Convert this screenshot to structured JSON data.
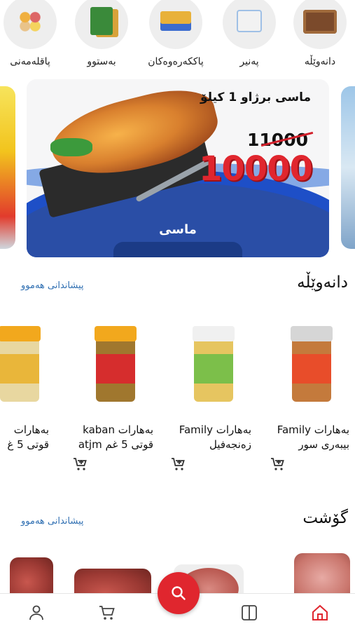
{
  "categories": [
    {
      "label": "پاقلەمەنی",
      "icon": "legumes-icon"
    },
    {
      "label": "بەستوو",
      "icon": "frozen-food-icon"
    },
    {
      "label": "پاککەرەوەکان",
      "icon": "cleaning-products-icon"
    },
    {
      "label": "پەنیر",
      "icon": "cheese-icon"
    },
    {
      "label": "دانەوێڵە",
      "icon": "grains-icon"
    }
  ],
  "banner": {
    "title": "ماسی برژاو 1 کیلۆ",
    "old_price": "11000",
    "new_price": "10000",
    "caption": "ماسی"
  },
  "sections": [
    {
      "title": "دانەوێڵە",
      "see_all": "پیشاندانی هەموو"
    },
    {
      "title": "گۆشت",
      "see_all": "پیشاندانی هەموو"
    }
  ],
  "products": [
    {
      "line1": "بەهارات Family",
      "line2": "بیبەری سور"
    },
    {
      "line1": "بەهارات Family",
      "line2": "زەنجەفیل"
    },
    {
      "line1": "بەهارات kaban",
      "line2": "قوتی 5 غم atjm"
    },
    {
      "line1": "بەهارات",
      "line2": "قوتی 5 غ"
    }
  ],
  "colors": {
    "accent": "#e0262e",
    "link": "#2f6fb2",
    "banner_blue": "#1e4fc7"
  },
  "nav": [
    "profile-icon",
    "cart-icon",
    "search-icon",
    "categories-icon",
    "home-icon"
  ]
}
